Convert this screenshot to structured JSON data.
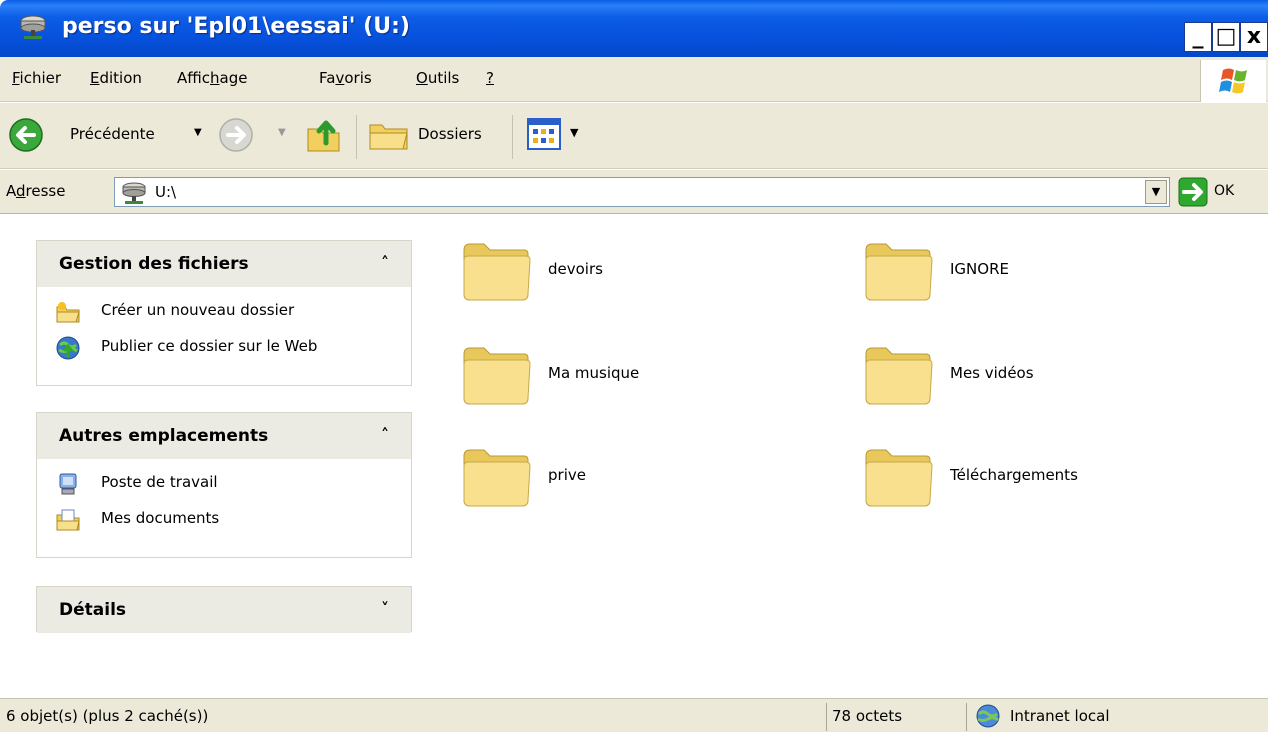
{
  "window": {
    "title": "perso sur 'Epl01\\eessai' (U:)",
    "controls": {
      "minimize": "_",
      "maximize": "□",
      "close": "x"
    }
  },
  "menu": {
    "items": [
      {
        "label": "Fichier",
        "accel": "F",
        "rest": "ichier"
      },
      {
        "label": "Edition",
        "accel": "E",
        "rest": "dition"
      },
      {
        "label": "Affichage",
        "pre": "Affic",
        "accel": "h",
        "rest": "age"
      },
      {
        "label": "Favoris",
        "pre": "Fa",
        "accel": "v",
        "rest": "oris"
      },
      {
        "label": "Outils",
        "accel": "O",
        "rest": "utils"
      },
      {
        "label": "?",
        "accel": "?",
        "rest": ""
      }
    ]
  },
  "toolbar": {
    "back_label": "Précédente",
    "folders_label": "Dossiers"
  },
  "address": {
    "label_pre": "A",
    "label_accel": "d",
    "label_rest": "resse",
    "value": "U:\\",
    "go_label": "OK"
  },
  "sidebar": {
    "file_tasks": {
      "title": "Gestion des fichiers",
      "toggle": "˄",
      "items": [
        {
          "label": "Créer un nouveau dossier",
          "icon": "new-folder-icon"
        },
        {
          "label": "Publier ce dossier sur le Web",
          "icon": "publish-web-icon"
        }
      ]
    },
    "other_places": {
      "title": "Autres emplacements",
      "toggle": "˄",
      "items": [
        {
          "label": "Poste de travail",
          "icon": "my-computer-icon"
        },
        {
          "label": "Mes documents",
          "icon": "my-documents-icon"
        }
      ]
    },
    "details": {
      "title": "Détails",
      "toggle": "˅"
    }
  },
  "folders": [
    {
      "name": "devoirs"
    },
    {
      "name": "IGNORE"
    },
    {
      "name": "Ma musique"
    },
    {
      "name": "Mes vidéos"
    },
    {
      "name": "prive"
    },
    {
      "name": "Téléchargements"
    }
  ],
  "status": {
    "objects": "6 objet(s) (plus 2 caché(s))",
    "size": "78 octets",
    "zone": "Intranet local"
  },
  "colors": {
    "titlebar": "#0650dc",
    "chrome": "#ece9d8",
    "pane_header": "#ecebe3",
    "folder_yellow": "#f6dc7a"
  }
}
